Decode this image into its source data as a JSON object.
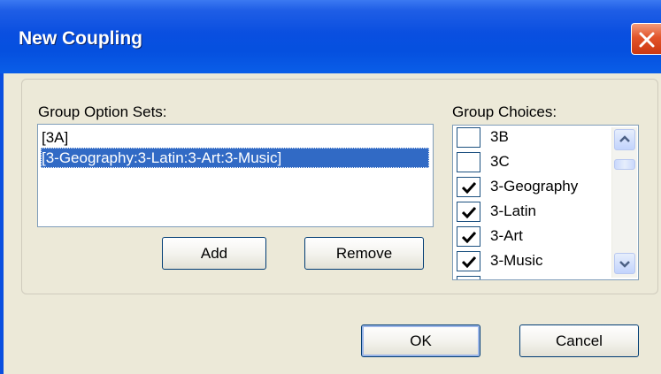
{
  "window": {
    "title": "New Coupling",
    "close_icon": "close-icon"
  },
  "option_sets": {
    "label": "Group Option Sets:",
    "items": [
      "[3A]",
      "[3-Geography:3-Latin:3-Art:3-Music]"
    ],
    "selected_index": 1
  },
  "buttons": {
    "add": "Add",
    "remove": "Remove",
    "ok": "OK",
    "cancel": "Cancel"
  },
  "choices": {
    "label": "Group Choices:",
    "items": [
      {
        "label": "3B",
        "checked": false
      },
      {
        "label": "3C",
        "checked": false
      },
      {
        "label": "3-Geography",
        "checked": true
      },
      {
        "label": "3-Latin",
        "checked": true
      },
      {
        "label": "3-Art",
        "checked": true
      },
      {
        "label": "3-Music",
        "checked": true
      }
    ]
  },
  "colors": {
    "title_bar": "#0a4fe0",
    "selection": "#316ac5",
    "dialog_bg": "#ece9d8",
    "close": "#e2542a"
  }
}
